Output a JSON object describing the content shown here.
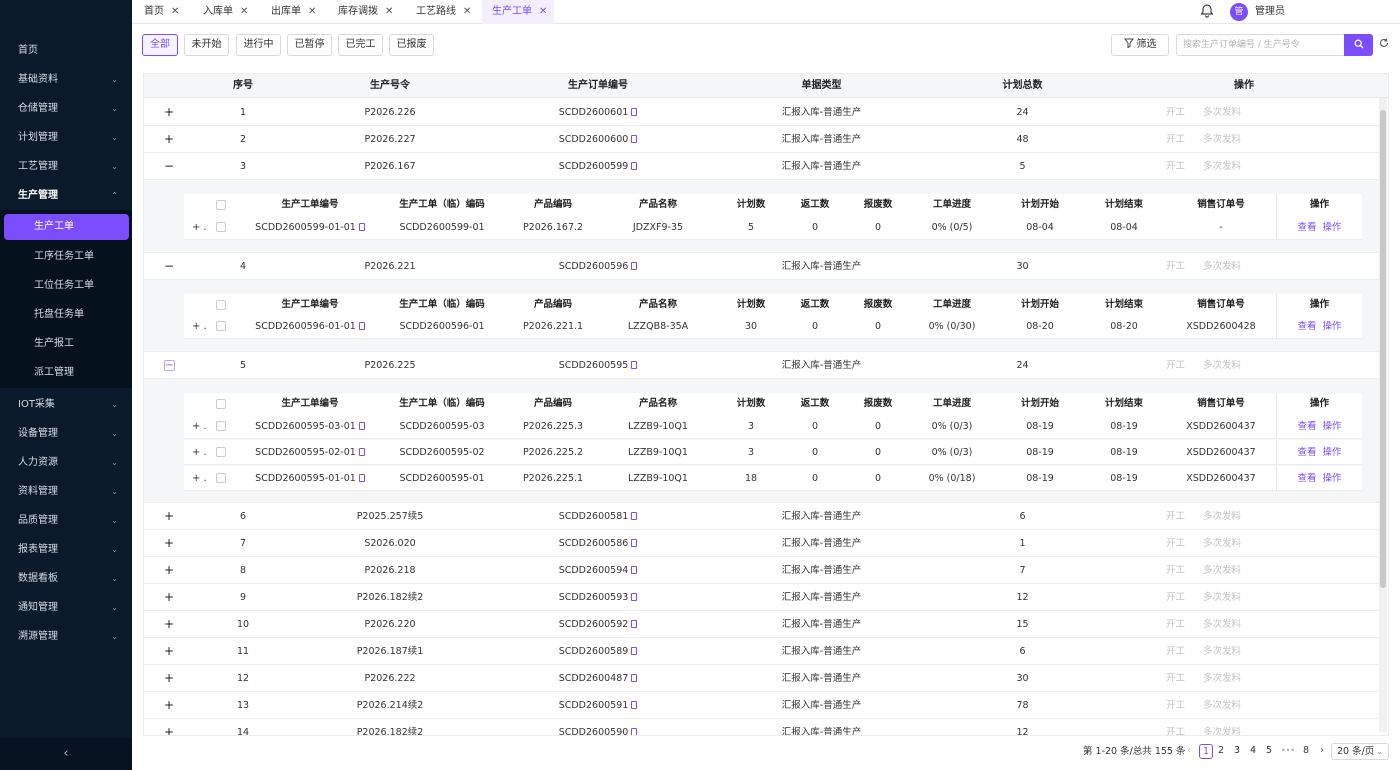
{
  "sidebar": {
    "items": [
      {
        "label": "首页",
        "chev": ""
      },
      {
        "label": "基础资料",
        "chev": "⌄"
      },
      {
        "label": "仓储管理",
        "chev": "⌄"
      },
      {
        "label": "计划管理",
        "chev": "⌄"
      },
      {
        "label": "工艺管理",
        "chev": "⌄"
      },
      {
        "label": "生产管理",
        "chev": "⌃"
      },
      {
        "label": "IOT采集",
        "chev": "⌄"
      },
      {
        "label": "设备管理",
        "chev": "⌄"
      },
      {
        "label": "人力资源",
        "chev": "⌄"
      },
      {
        "label": "资料管理",
        "chev": "⌄"
      },
      {
        "label": "品质管理",
        "chev": "⌄"
      },
      {
        "label": "报表管理",
        "chev": "⌄"
      },
      {
        "label": "数据看板",
        "chev": "⌄"
      },
      {
        "label": "通知管理",
        "chev": "⌄"
      },
      {
        "label": "溯源管理",
        "chev": "⌄"
      }
    ],
    "sub_items": [
      "生产工单",
      "工序任务工单",
      "工位任务工单",
      "托盘任务单",
      "生产报工",
      "派工管理"
    ],
    "collapse": "‹"
  },
  "tabs": [
    {
      "label": "首页",
      "close": "✕"
    },
    {
      "label": "入库单",
      "close": "✕"
    },
    {
      "label": "出库单",
      "close": "✕"
    },
    {
      "label": "库存调拨",
      "close": "✕"
    },
    {
      "label": "工艺路线",
      "close": "✕"
    },
    {
      "label": "生产工单",
      "close": "✕"
    }
  ],
  "user": {
    "avatar": "管",
    "name": "管理员"
  },
  "status_filters": [
    "全部",
    "未开始",
    "进行中",
    "已暂停",
    "已完工",
    "已报废"
  ],
  "toolbar": {
    "filter_label": "筛选",
    "search_placeholder": "搜索生产订单编号 / 生产号令"
  },
  "table": {
    "columns": [
      "序号",
      "生产号令",
      "生产订单编号",
      "单据类型",
      "计划总数",
      "操作"
    ],
    "actions": [
      "开工",
      "多次发料"
    ],
    "rows": [
      {
        "exp": "+",
        "no": "1",
        "cmd": "P2026.226",
        "order": "SCDD2600601",
        "type": "汇报入库-普通生产",
        "qty": "24"
      },
      {
        "exp": "+",
        "no": "2",
        "cmd": "P2026.227",
        "order": "SCDD2600600",
        "type": "汇报入库-普通生产",
        "qty": "48"
      },
      {
        "exp": "−",
        "no": "3",
        "cmd": "P2026.167",
        "order": "SCDD2600599",
        "type": "汇报入库-普通生产",
        "qty": "5"
      },
      {
        "exp": "−",
        "no": "4",
        "cmd": "P2026.221",
        "order": "SCDD2600596",
        "type": "汇报入库-普通生产",
        "qty": "30"
      },
      {
        "exp": "−",
        "no": "5",
        "cmd": "P2026.225",
        "order": "SCDD2600595",
        "type": "汇报入库-普通生产",
        "qty": "24"
      },
      {
        "exp": "+",
        "no": "6",
        "cmd": "P2025.257续5",
        "order": "SCDD2600581",
        "type": "汇报入库-普通生产",
        "qty": "6"
      },
      {
        "exp": "+",
        "no": "7",
        "cmd": "S2026.020",
        "order": "SCDD2600586",
        "type": "汇报入库-普通生产",
        "qty": "1"
      },
      {
        "exp": "+",
        "no": "8",
        "cmd": "P2026.218",
        "order": "SCDD2600594",
        "type": "汇报入库-普通生产",
        "qty": "7"
      },
      {
        "exp": "+",
        "no": "9",
        "cmd": "P2026.182续2",
        "order": "SCDD2600593",
        "type": "汇报入库-普通生产",
        "qty": "12"
      },
      {
        "exp": "+",
        "no": "10",
        "cmd": "P2026.220",
        "order": "SCDD2600592",
        "type": "汇报入库-普通生产",
        "qty": "15"
      },
      {
        "exp": "+",
        "no": "11",
        "cmd": "P2026.187续1",
        "order": "SCDD2600589",
        "type": "汇报入库-普通生产",
        "qty": "6"
      },
      {
        "exp": "+",
        "no": "12",
        "cmd": "P2026.222",
        "order": "SCDD2600487",
        "type": "汇报入库-普通生产",
        "qty": "30"
      },
      {
        "exp": "+",
        "no": "13",
        "cmd": "P2026.214续2",
        "order": "SCDD2600591",
        "type": "汇报入库-普通生产",
        "qty": "78"
      },
      {
        "exp": "+",
        "no": "14",
        "cmd": "P2026.182续2",
        "order": "SCDD2600590",
        "type": "汇报入库-普通生产",
        "qty": "12"
      }
    ],
    "sub_columns": [
      "生产工单编号",
      "生产工单（临）编码",
      "产品编码",
      "产品名称",
      "计划数",
      "返工数",
      "报废数",
      "工单进度",
      "计划开始",
      "计划结束",
      "销售订单号",
      "操作"
    ],
    "sub_actions": [
      "查看",
      "操作"
    ],
    "sub_rows": [
      [
        {
          "code": "SCDD2600599-01-01",
          "tmp": "SCDD2600599-01",
          "pcode": "P2026.167.2",
          "pname": "JDZXF9-35",
          "plan": "5",
          "rework": "0",
          "scrap": "0",
          "progress": "0% (0/5)",
          "start": "08-04",
          "end": "08-04",
          "sale": "-"
        }
      ],
      [
        {
          "code": "SCDD2600596-01-01",
          "tmp": "SCDD2600596-01",
          "pcode": "P2026.221.1",
          "pname": "LZZQB8-35A",
          "plan": "30",
          "rework": "0",
          "scrap": "0",
          "progress": "0% (0/30)",
          "start": "08-20",
          "end": "08-20",
          "sale": "XSDD2600428"
        }
      ],
      [
        {
          "code": "SCDD2600595-03-01",
          "tmp": "SCDD2600595-03",
          "pcode": "P2026.225.3",
          "pname": "LZZB9-10Q1",
          "plan": "3",
          "rework": "0",
          "scrap": "0",
          "progress": "0% (0/3)",
          "start": "08-19",
          "end": "08-19",
          "sale": "XSDD2600437"
        },
        {
          "code": "SCDD2600595-02-01",
          "tmp": "SCDD2600595-02",
          "pcode": "P2026.225.2",
          "pname": "LZZB9-10Q1",
          "plan": "3",
          "rework": "0",
          "scrap": "0",
          "progress": "0% (0/3)",
          "start": "08-19",
          "end": "08-19",
          "sale": "XSDD2600437"
        },
        {
          "code": "SCDD2600595-01-01",
          "tmp": "SCDD2600595-01",
          "pcode": "P2026.225.1",
          "pname": "LZZB9-10Q1",
          "plan": "18",
          "rework": "0",
          "scrap": "0",
          "progress": "0% (0/18)",
          "start": "08-19",
          "end": "08-19",
          "sale": "XSDD2600437"
        }
      ]
    ]
  },
  "pagination": {
    "summary": "第 1-20 条/总共 155 条",
    "prev": "‹",
    "pages": [
      "1",
      "2",
      "3",
      "4",
      "5",
      "•••",
      "8"
    ],
    "next": "›",
    "page_size": "20 条/页",
    "current": 1
  },
  "colors": {
    "accent": "#7c4dff",
    "sidebar_bg": "#0b1a2b"
  }
}
